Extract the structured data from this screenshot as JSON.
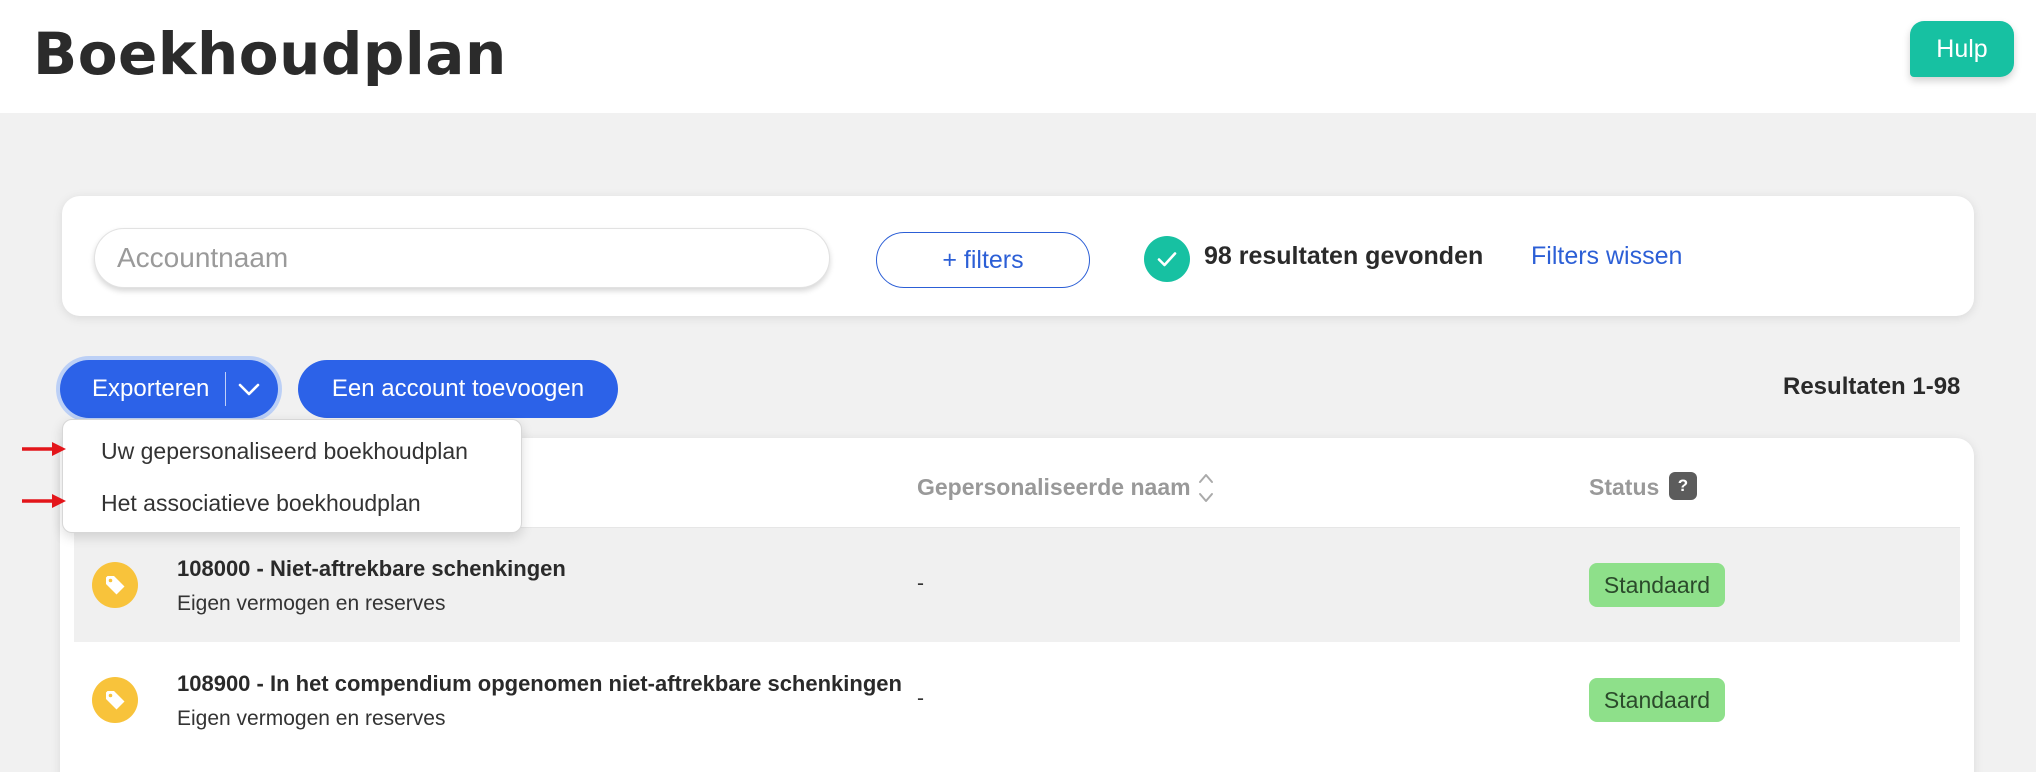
{
  "header": {
    "title": "Boekhoudplan",
    "help_label": "Hulp"
  },
  "search": {
    "placeholder": "Accountnaam",
    "filters_label": "+ filters",
    "results_found": "98 resultaten gevonden",
    "clear_filters": "Filters wissen"
  },
  "toolbar": {
    "export_label": "Exporteren",
    "add_label": "Een account toevoogen",
    "results_range": "Resultaten 1-98"
  },
  "export_menu": {
    "items": [
      {
        "label": "Uw gepersonaliseerd boekhoudplan"
      },
      {
        "label": "Het associatieve boekhoudplan"
      }
    ]
  },
  "table": {
    "columns": {
      "personalized_name": "Gepersonaliseerde naam",
      "status": "Status",
      "status_help": "?"
    },
    "rows": [
      {
        "title": "108000 - Niet-aftrekbare schenkingen",
        "subtitle": "Eigen vermogen en reserves",
        "personalized_name": "-",
        "status": "Standaard"
      },
      {
        "title": "108900 - In het compendium opgenomen niet-aftrekbare schenkingen",
        "subtitle": "Eigen vermogen en reserves",
        "personalized_name": "-",
        "status": "Standaard"
      }
    ]
  },
  "colors": {
    "primary": "#2c62e8",
    "accent": "#17c1a2",
    "tag": "#f8c33b",
    "status_bg": "#8ee08a",
    "annotation_arrow": "#e3151a"
  },
  "icons": {
    "help_button": "none",
    "result_check": "check-icon",
    "export_toggle": "chevron-down-icon",
    "sort": "sort-icon",
    "row_tag": "tag-icon",
    "annotation": "red-arrow-icon"
  }
}
